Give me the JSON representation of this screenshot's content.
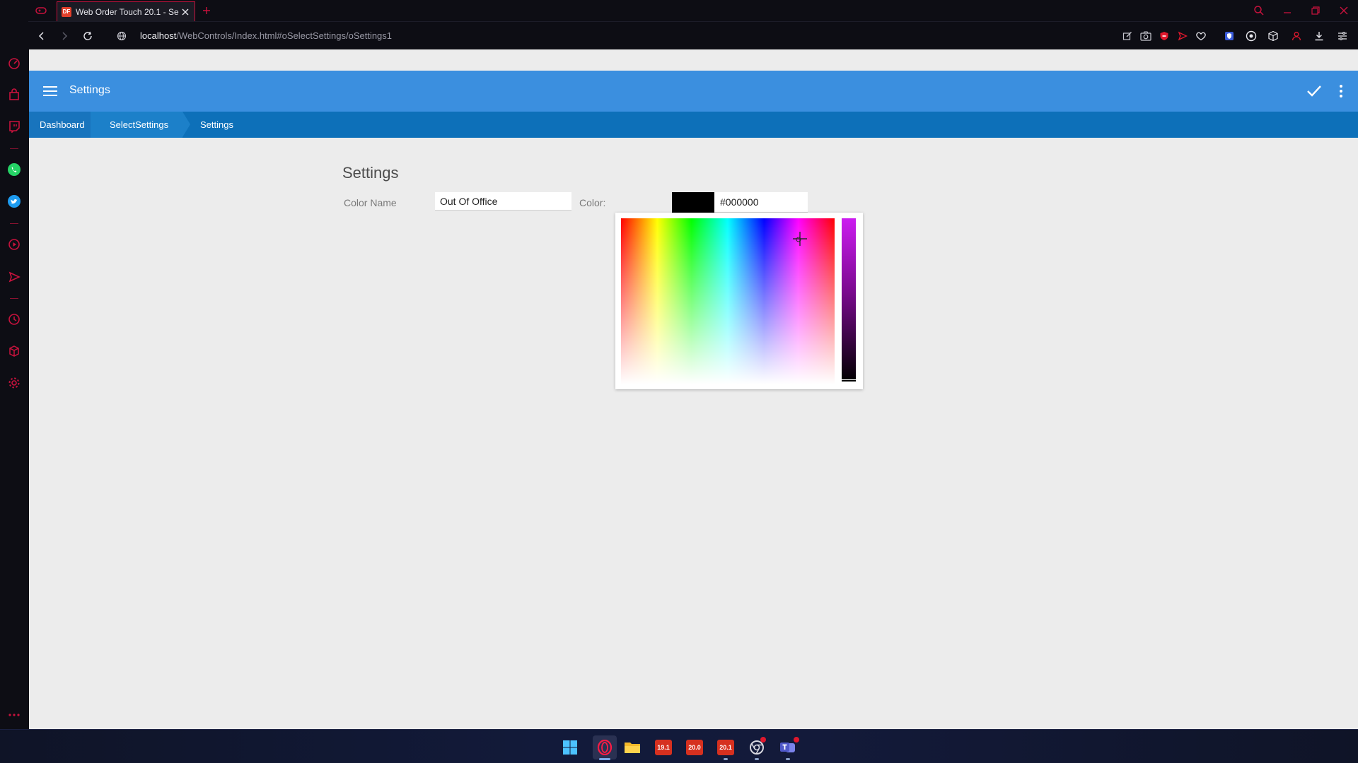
{
  "browser": {
    "tab": {
      "title": "Web Order Touch 20.1 - Se",
      "favicon_text": "DF"
    },
    "url": {
      "host": "localhost",
      "path": "/WebControls/Index.html#oSelectSettings/oSettings1"
    }
  },
  "app": {
    "title": "Settings",
    "breadcrumbs": [
      {
        "label": "Dashboard"
      },
      {
        "label": "SelectSettings"
      },
      {
        "label": "Settings"
      }
    ]
  },
  "form": {
    "heading": "Settings",
    "color_name_label": "Color Name",
    "color_name_value": "Out Of Office",
    "color_label": "Color:",
    "color_hex": "#000000"
  },
  "taskbar": {
    "apps": [
      {
        "name": "start",
        "label": ""
      },
      {
        "name": "opera",
        "label": ""
      },
      {
        "name": "file-explorer",
        "label": ""
      },
      {
        "name": "dataflex-19",
        "label": "19.1"
      },
      {
        "name": "dataflex-20",
        "label": "20.0"
      },
      {
        "name": "dataflex-20-1",
        "label": "20.1"
      }
    ]
  },
  "colors": {
    "accent_blue": "#3b8fdf",
    "breadcrumb_blue": "#0d70b9",
    "opera_red": "#e0182d"
  }
}
